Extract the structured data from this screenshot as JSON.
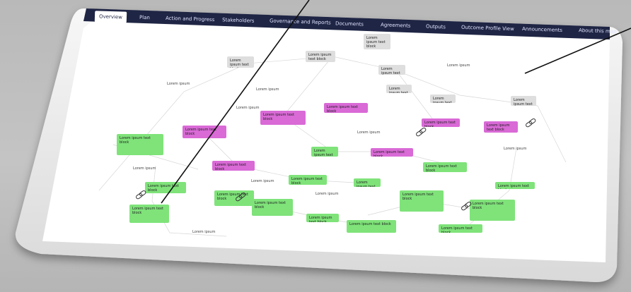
{
  "nav": {
    "tabs": [
      {
        "label": "Overview",
        "active": true
      },
      {
        "label": "Plan",
        "active": false
      },
      {
        "label": "Action and Progress",
        "active": false
      },
      {
        "label": "Stakeholders",
        "active": false
      },
      {
        "label": "Governance and Reports",
        "active": false
      },
      {
        "label": "Documents",
        "active": false
      },
      {
        "label": "Agreements",
        "active": false
      },
      {
        "label": "Outputs",
        "active": false
      },
      {
        "label": "Outcome Profile View",
        "active": false
      },
      {
        "label": "Announcements",
        "active": false
      },
      {
        "label": "About this map",
        "active": false
      }
    ]
  },
  "map": {
    "gray_nodes": [
      {
        "text": "Lorem ipsum text block"
      },
      {
        "text": "Lorem ipsum text block"
      },
      {
        "text": "Lorem ipsum text block"
      },
      {
        "text": "Lorem ipsum text block"
      },
      {
        "text": "Lorem ipsum text block"
      },
      {
        "text": "Lorem ipsum text block"
      },
      {
        "text": "Lorem ipsum text block"
      }
    ],
    "purple_nodes": [
      {
        "text": "Lorem ipsum text block"
      },
      {
        "text": "Lorem ipsum text block"
      },
      {
        "text": "Lorem ipsum text block"
      },
      {
        "text": "Lorem ipsum text block"
      },
      {
        "text": "Lorem ipsum text block"
      },
      {
        "text": "Lorem ipsum text block"
      },
      {
        "text": "Lorem ipsum text block"
      }
    ],
    "green_nodes": [
      {
        "text": "Lorem ipsum text block"
      },
      {
        "text": "Lorem ipsum text block"
      },
      {
        "text": "Lorem ipsum text block"
      },
      {
        "text": "Lorem ipsum text block"
      },
      {
        "text": "Lorem ipsum text block"
      },
      {
        "text": "Lorem ipsum text block"
      },
      {
        "text": "Lorem ipsum text block"
      },
      {
        "text": "Lorem ipsum text block"
      },
      {
        "text": "Lorem ipsum text block"
      },
      {
        "text": "Lorem ipsum text block"
      },
      {
        "text": "Lorem ipsum text block"
      },
      {
        "text": "Lorem ipsum text block"
      },
      {
        "text": "Lorem ipsum text block"
      },
      {
        "text": "Lorem ipsum text block"
      },
      {
        "text": "Lorem ipsum text block"
      }
    ],
    "labels": [
      {
        "text": "Lorem ipsum"
      },
      {
        "text": "Lorem ipsum"
      },
      {
        "text": "Lorem ipsum"
      },
      {
        "text": "Lorem ipsum"
      },
      {
        "text": "Lorem ipsum"
      },
      {
        "text": "Lorem ipsum"
      },
      {
        "text": "Lorem ipsum"
      },
      {
        "text": "Lorem ipsum"
      },
      {
        "text": "Lorem ipsum"
      },
      {
        "text": "Lorem ipsum"
      }
    ]
  },
  "colors": {
    "nav_bg": "#1f2544",
    "green": "#7fe37a",
    "purple": "#d96ad6",
    "gray": "#dedede",
    "canvas": "#ffffff",
    "background": "#bcbcbc"
  },
  "icons": [
    "link-icon",
    "pointer-line"
  ]
}
